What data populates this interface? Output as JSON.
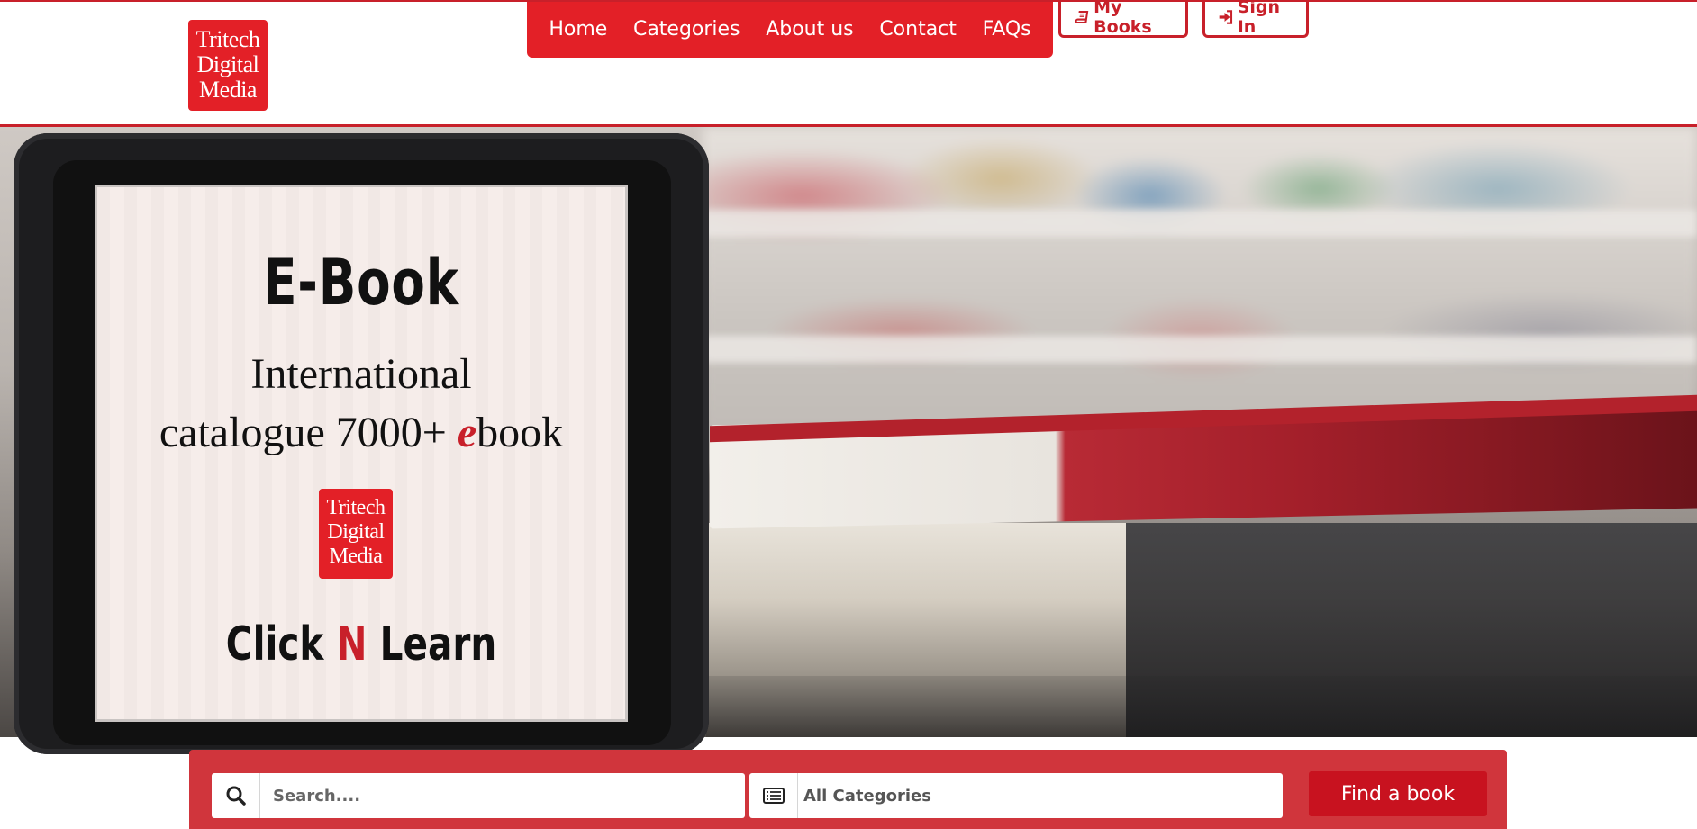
{
  "brand": {
    "logo_lines": [
      "Tritech",
      "Digital",
      "Media"
    ],
    "accent": "#e32027",
    "accent_dark": "#c8202a"
  },
  "nav": {
    "items": [
      "Home",
      "Categories",
      "About us",
      "Contact",
      "FAQs"
    ]
  },
  "header_buttons": {
    "my_books": "My Books",
    "my_books_icon": "book-icon",
    "sign_in": "Sign In",
    "sign_in_icon": "sign-in-icon"
  },
  "hero": {
    "title": "E-Book",
    "line1": "International",
    "line2_prefix": "catalogue 7000+ ",
    "line2_e": "e",
    "line2_suffix": "book",
    "mini_logo_lines": [
      "Tritech",
      "Digital",
      "Media"
    ],
    "tagline_click": "Click",
    "tagline_n": "N",
    "tagline_learn": "Learn"
  },
  "search": {
    "placeholder": "Search....",
    "search_icon": "search-icon",
    "category_icon": "list-icon",
    "category_value": "All Categories",
    "button_label": "Find a book"
  }
}
